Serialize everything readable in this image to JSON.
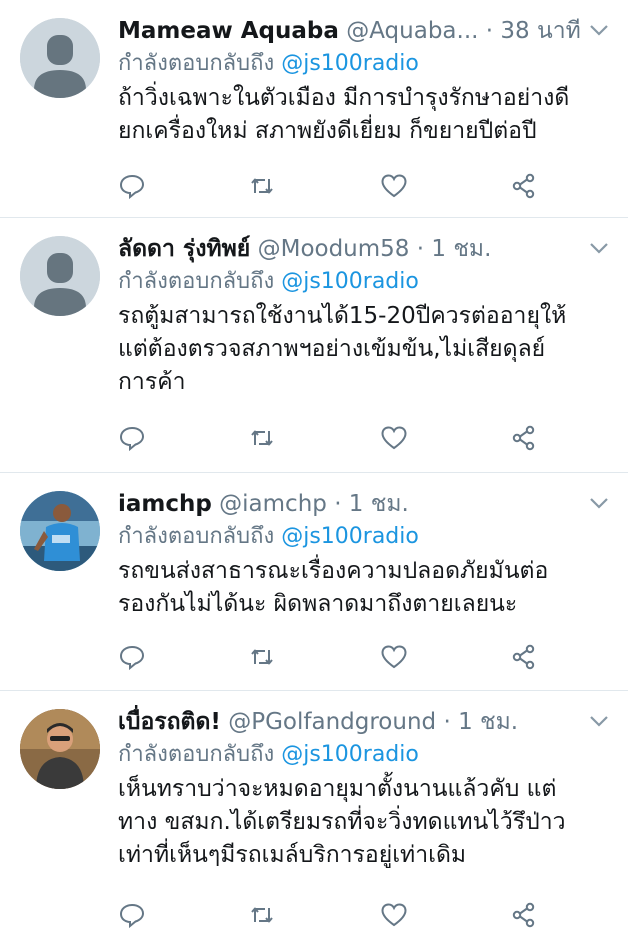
{
  "tweets": [
    {
      "name": "Mameaw Aquaba",
      "handle": "@Aquaba...",
      "time": "· 38 นาที",
      "reply_prefix": "กำลังตอบกลับถึง",
      "reply_to": "@js100radio",
      "body": [
        "ถ้าวิ่งเฉพาะในตัวเมือง  มีการบำรุงรักษาอย่างดี",
        "ยกเครื่องใหม่  สภาพยังดีเยี่ยม ก็ขยายปีต่อปี"
      ],
      "avatar": "default-avatar"
    },
    {
      "name": "ลัดดา รุ่งทิพย์",
      "handle": "@Moodum58",
      "time": "· 1 ชม.",
      "reply_prefix": "กำลังตอบกลับถึง",
      "reply_to": "@js100radio",
      "body": [
        "รถตู้มสามารถใช้งานได้15-20ปีควรต่ออายุให้",
        "แต่ต้องตรวจสภาพฯอย่างเข้มข้น,ไม่เสียดุลย์",
        "การค้า"
      ],
      "avatar": "default-avatar"
    },
    {
      "name": "iamchp",
      "handle": "@iamchp",
      "time": "· 1 ชม.",
      "reply_prefix": "กำลังตอบกลับถึง",
      "reply_to": "@js100radio",
      "body": [
        "รถขนส่งสาธารณะเรื่องความปลอดภัยมันต่อ",
        "รองกันไม่ได้นะ ผิดพลาดมาถึงตายเลยนะ"
      ],
      "avatar": "runner-photo"
    },
    {
      "name": "เบื่อรถติด!",
      "handle": "@PGolfandground",
      "time": "· 1 ชม.",
      "reply_prefix": "กำลังตอบกลับถึง",
      "reply_to": "@js100radio",
      "body": [
        "เห็นทราบว่าจะหมดอายุมาตั้งนานแล้วคับ แต่",
        "ทาง ขสมก.ได้เตรียมรถที่จะวิ่งทดแทนไว้รึป่าว",
        "เท่าที่เห็นๆมีรถเมล์บริการอยู่เท่าเดิม"
      ],
      "avatar": "man-portrait-photo"
    }
  ],
  "colors": {
    "text": "#14171a",
    "muted": "#657786",
    "link": "#1b95e0",
    "divider": "#e1e8ed"
  },
  "icons": [
    "reply-icon",
    "retweet-icon",
    "like-icon",
    "share-icon",
    "chevron-down-icon"
  ]
}
